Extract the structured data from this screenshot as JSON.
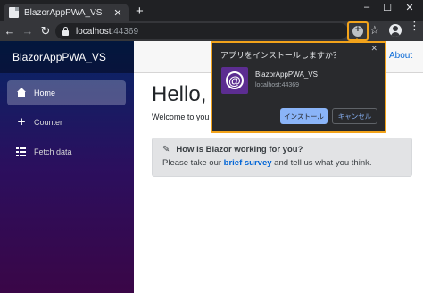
{
  "browser": {
    "tab": {
      "title": "BlazorAppPWA_VS",
      "close_glyph": "✕"
    },
    "new_tab_glyph": "+",
    "window_controls": {
      "minimize": "–",
      "maximize": "☐",
      "close": "✕"
    },
    "toolbar": {
      "back_glyph": "←",
      "forward_glyph": "→",
      "reload_glyph": "↻",
      "url_host": "localhost",
      "url_port": ":44369",
      "star_glyph": "☆",
      "menu_glyph": "⋮"
    },
    "accent_color": "#f2a31b"
  },
  "install_dialog": {
    "title": "アプリをインストールしますか？",
    "close_glyph": "✕",
    "app_name": "BlazorAppPWA_VS",
    "app_host": "localhost:44369",
    "app_icon_glyph": "@",
    "install_label": "インストール",
    "cancel_label": "キャンセル"
  },
  "sidebar": {
    "brand": "BlazorAppPWA_VS",
    "items": [
      {
        "label": "Home",
        "icon": "home-icon",
        "active": true
      },
      {
        "label": "Counter",
        "icon": "plus-icon",
        "active": false
      },
      {
        "label": "Fetch data",
        "icon": "list-icon",
        "active": false
      }
    ]
  },
  "main": {
    "about_link": "About",
    "heading": "Hello,",
    "welcome": "Welcome to you",
    "alert": {
      "title": "How is Blazor working for you?",
      "text_before": "Please take our ",
      "link": "brief survey",
      "text_after": " and tell us what you think."
    }
  }
}
